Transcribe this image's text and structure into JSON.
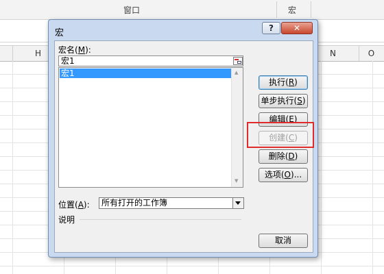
{
  "excel": {
    "ribbon_groups": [
      "窗口",
      "宏"
    ],
    "column_headers": [
      "H",
      "N",
      "O"
    ]
  },
  "dialog": {
    "title": "宏",
    "help_label": "?",
    "close_label": "✕",
    "macro_name_label": "宏名",
    "macro_name_key": "M",
    "macro_name_value": "宏1",
    "macros": [
      "宏1"
    ],
    "location_label": "位置",
    "location_key": "A",
    "location_value": "所有打开的工作簿",
    "description_label": "说明",
    "buttons": {
      "run": {
        "text": "执行",
        "key": "R"
      },
      "step_into": {
        "text": "单步执行",
        "key": "S"
      },
      "edit": {
        "text": "编辑",
        "key": "E"
      },
      "create": {
        "text": "创建",
        "key": "C"
      },
      "delete": {
        "text": "删除",
        "key": "D"
      },
      "options": {
        "text": "选项",
        "key": "O",
        "suffix": "..."
      },
      "cancel": {
        "text": "取消"
      }
    }
  },
  "highlight_color": "#e02b2b"
}
